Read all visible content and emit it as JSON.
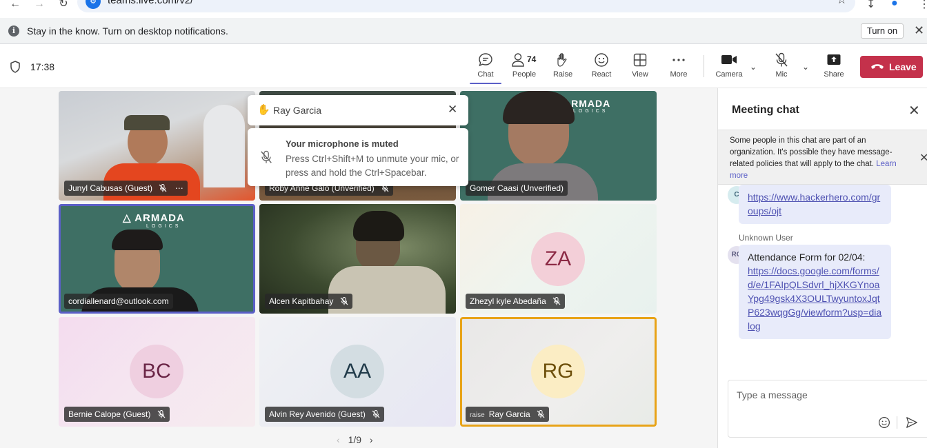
{
  "browser": {
    "url": "teams.live.com/v2/"
  },
  "notification": {
    "text": "Stay in the know. Turn on desktop notifications.",
    "turn_on_label": "Turn on"
  },
  "header": {
    "time": "17:38",
    "chat_label": "Chat",
    "people_label": "People",
    "people_count": "74",
    "raise_label": "Raise",
    "react_label": "React",
    "view_label": "View",
    "more_label": "More",
    "camera_label": "Camera",
    "mic_label": "Mic",
    "share_label": "Share",
    "leave_label": "Leave"
  },
  "tiles": [
    {
      "name": "Junyl Cabusas (Guest)",
      "type": "video"
    },
    {
      "name": "Roby Anne Galo (Unverified)",
      "type": "video"
    },
    {
      "name": "Gomer Caasi (Unverified)",
      "type": "video"
    },
    {
      "name": "cordiallenard@outlook.com",
      "type": "video"
    },
    {
      "name": "Alcen Kapitbahay",
      "type": "video"
    },
    {
      "name": "Zhezyl kyle Abedaña",
      "initials": "ZA",
      "type": "avatar"
    },
    {
      "name": "Bernie Calope (Guest)",
      "initials": "BC",
      "type": "avatar"
    },
    {
      "name": "Alvin Rey Avenido (Guest)",
      "initials": "AA",
      "type": "avatar"
    },
    {
      "name": "Ray Garcia",
      "initials": "RG",
      "type": "avatar",
      "raise_alt": "raise"
    }
  ],
  "armada_logo": "ARMADA",
  "armada_sub": "LOGICS",
  "pager": "1/9",
  "raise_popup": {
    "name": "Ray Garcia"
  },
  "mute_popup": {
    "title": "Your microphone is muted",
    "body": "Press Ctrl+Shift+M to unmute your mic, or press and hold the Ctrl+Spacebar."
  },
  "chat": {
    "title": "Meeting chat",
    "policy_text": "Some people in this chat are part of an organization. It's possible they have message-related policies that will apply to the chat.",
    "policy_link": "Learn more",
    "messages": [
      {
        "avatar": "C",
        "text": "",
        "link": "https://www.hackerhero.com/groups/ojt"
      },
      {
        "sender": "Unknown User",
        "avatar": "RG",
        "text": "Attendance Form for 02/04:",
        "link": "https://docs.google.com/forms/d/e/1FAIpQLSdvrl_hjXKGYnoaYpg49gsk4X3OULTwyuntoxJqtP623wqgGg/viewform?usp=dialog"
      }
    ],
    "compose_placeholder": "Type a message"
  },
  "colors": {
    "accent": "#5b5fc7",
    "leave": "#c4314b",
    "raise_border": "#e8a317"
  }
}
